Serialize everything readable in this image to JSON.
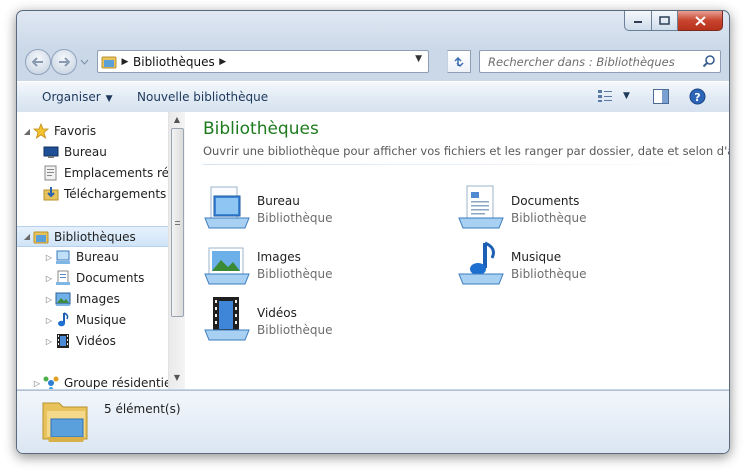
{
  "window": {
    "address": {
      "crumb": "Bibliothèques"
    },
    "search": {
      "placeholder": "Rechercher dans : Bibliothèques"
    }
  },
  "toolbar": {
    "organize_label": "Organiser",
    "new_library_label": "Nouvelle bibliothèque"
  },
  "nav": {
    "favorites": {
      "label": "Favoris",
      "items": [
        {
          "label": "Bureau",
          "icon": "desktop-icon"
        },
        {
          "label": "Emplacements récents",
          "icon": "recent-places-icon"
        },
        {
          "label": "Téléchargements",
          "icon": "downloads-icon"
        }
      ]
    },
    "libraries": {
      "label": "Bibliothèques",
      "items": [
        {
          "label": "Bureau",
          "icon": "desktop-library-icon"
        },
        {
          "label": "Documents",
          "icon": "documents-icon"
        },
        {
          "label": "Images",
          "icon": "images-icon"
        },
        {
          "label": "Musique",
          "icon": "music-icon"
        },
        {
          "label": "Vidéos",
          "icon": "videos-icon"
        }
      ]
    },
    "homegroup": {
      "label": "Groupe résidentiel"
    }
  },
  "content": {
    "title": "Bibliothèques",
    "subtitle": "Ouvrir une bibliothèque pour afficher vos fichiers et les ranger par dossier, date et selon d'a...",
    "items": [
      {
        "name": "Bureau",
        "type": "Bibliothèque",
        "icon": "desktop-library-icon"
      },
      {
        "name": "Documents",
        "type": "Bibliothèque",
        "icon": "documents-library-icon"
      },
      {
        "name": "Images",
        "type": "Bibliothèque",
        "icon": "images-library-icon"
      },
      {
        "name": "Musique",
        "type": "Bibliothèque",
        "icon": "music-library-icon"
      },
      {
        "name": "Vidéos",
        "type": "Bibliothèque",
        "icon": "videos-library-icon"
      }
    ]
  },
  "details": {
    "count": "5 élément(s)"
  },
  "colors": {
    "title_green": "#1e7b1e",
    "close_red": "#c7442e",
    "toolbar_text": "#1e395b"
  }
}
